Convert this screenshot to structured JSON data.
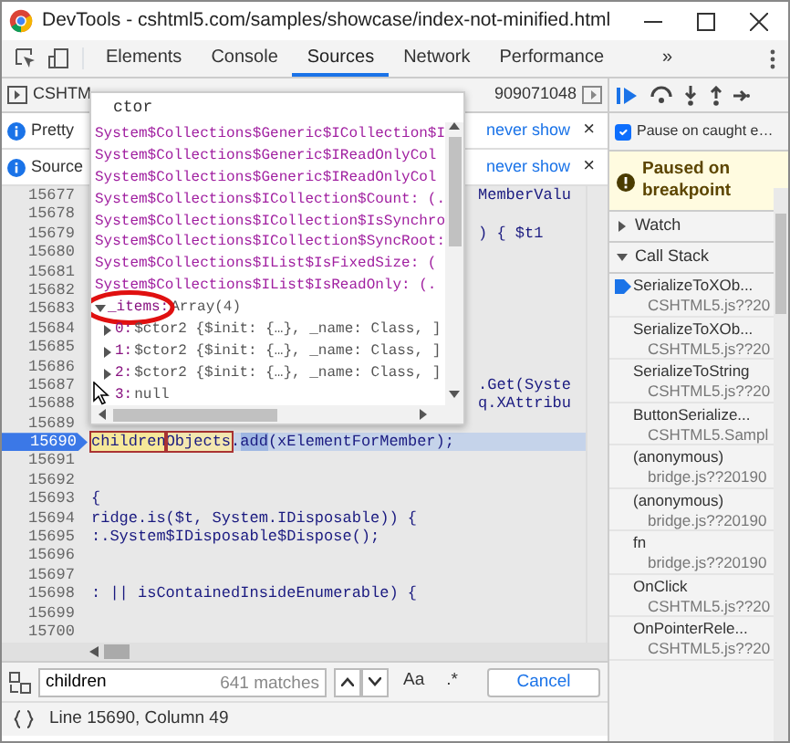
{
  "window": {
    "title": "DevTools - cshtml5.com/samples/showcase/index-not-minified.html"
  },
  "tabs": [
    {
      "label": "Elements",
      "selected": false
    },
    {
      "label": "Console",
      "selected": false
    },
    {
      "label": "Sources",
      "selected": true
    },
    {
      "label": "Network",
      "selected": false
    },
    {
      "label": "Performance",
      "selected": false
    }
  ],
  "overflow_button": "»",
  "file_tabs": [
    {
      "label": "CSHTM"
    },
    {
      "label": "909071048"
    }
  ],
  "notices": [
    {
      "text": "Pretty",
      "link": "never show",
      "close": "×"
    },
    {
      "text": "Source",
      "link": "never show",
      "close": "×"
    }
  ],
  "code_lines": [
    {
      "number": "15677",
      "kind": "tail",
      "code": "MemberValu"
    },
    {
      "number": "15678",
      "kind": "empty"
    },
    {
      "number": "15679",
      "kind": "tail",
      "code": ") {  $t1"
    },
    {
      "number": "15680",
      "kind": "empty"
    },
    {
      "number": "15681",
      "kind": "empty"
    },
    {
      "number": "15682",
      "kind": "empty"
    },
    {
      "number": "15683",
      "kind": "empty"
    },
    {
      "number": "15684",
      "kind": "empty"
    },
    {
      "number": "15685",
      "kind": "empty"
    },
    {
      "number": "15686",
      "kind": "empty"
    },
    {
      "number": "15687",
      "kind": "tail",
      "code": ".Get(Syste"
    },
    {
      "number": "15688",
      "kind": "tail",
      "code": "q.XAttribu"
    },
    {
      "number": "15689",
      "kind": "empty"
    },
    {
      "number": "15690",
      "kind": "current",
      "segments": [
        {
          "text": "children",
          "kind": "match"
        },
        {
          "text": "Objects",
          "kind": "hover"
        },
        {
          "text": ".",
          "kind": "plain"
        },
        {
          "text": "add",
          "kind": "selected"
        },
        {
          "text": "(xElementForMember);",
          "kind": "plain"
        }
      ]
    },
    {
      "number": "15691",
      "kind": "empty"
    },
    {
      "number": "15692",
      "kind": "empty"
    },
    {
      "number": "15693",
      "kind": "plain",
      "code": "{"
    },
    {
      "number": "15694",
      "kind": "plain",
      "code": "ridge.is($t, System.IDisposable)) {"
    },
    {
      "number": "15695",
      "kind": "plain",
      "code": ":.System$IDisposable$Dispose();"
    },
    {
      "number": "15696",
      "kind": "empty"
    },
    {
      "number": "15697",
      "kind": "empty"
    },
    {
      "number": "15698",
      "kind": "plain",
      "code": ": || isContainedInsideEnumerable) {"
    },
    {
      "number": "15699",
      "kind": "empty"
    },
    {
      "number": "15700",
      "kind": "empty"
    }
  ],
  "autocomplete": {
    "query": "ctor",
    "items": [
      "System$Collections$Generic$ICollection$I",
      "System$Collections$Generic$IReadOnlyCol",
      "System$Collections$Generic$IReadOnlyCol",
      "System$Collections$ICollection$Count: (.",
      "System$Collections$ICollection$IsSynchro",
      "System$Collections$ICollection$SyncRoot:",
      "System$Collections$IList$IsFixedSize: (",
      "System$Collections$IList$IsReadOnly: (."
    ],
    "tree": {
      "key": "_items:",
      "value": "Array(4)",
      "expanded": true,
      "children": [
        {
          "key": "0:",
          "value": "$ctor2 {$init: {…}, _name: Class, ]",
          "expandable": true
        },
        {
          "key": "1:",
          "value": "$ctor2 {$init: {…}, _name: Class, ]",
          "expandable": true
        },
        {
          "key": "2:",
          "value": "$ctor2 {$init: {…}, _name: Class, ]",
          "expandable": true
        },
        {
          "key": "3:",
          "value": "null",
          "expandable": false
        }
      ]
    }
  },
  "search": {
    "value": "children",
    "count": "641 matches",
    "match_case": "Aa",
    "regex": ".*",
    "cancel": "Cancel"
  },
  "status": {
    "position": "Line 15690, Column 49"
  },
  "debugger": {
    "pause_on_caught": {
      "label": "Pause on caught e…",
      "checked": true
    },
    "paused_message": "Paused on breakpoint",
    "sections": [
      {
        "title": "Watch",
        "expanded": false
      },
      {
        "title": "Call Stack",
        "expanded": true
      }
    ],
    "call_stack": [
      {
        "function": "SerializeToXOb...",
        "location": "CSHTML5.js??20",
        "selected": true
      },
      {
        "function": "SerializeToXOb...",
        "location": "CSHTML5.js??20",
        "selected": false
      },
      {
        "function": "SerializeToString",
        "location": "CSHTML5.js??20",
        "selected": false
      },
      {
        "function": "ButtonSerialize...",
        "location": "CSHTML5.Sampl",
        "selected": false
      },
      {
        "function": "(anonymous)",
        "location": "bridge.js??20190",
        "selected": false
      },
      {
        "function": "(anonymous)",
        "location": "bridge.js??20190",
        "selected": false
      },
      {
        "function": "fn",
        "location": "bridge.js??20190",
        "selected": false
      },
      {
        "function": "OnClick",
        "location": "CSHTML5.js??20",
        "selected": false
      },
      {
        "function": "OnPointerRele...",
        "location": "CSHTML5.js??20",
        "selected": false
      }
    ]
  }
}
